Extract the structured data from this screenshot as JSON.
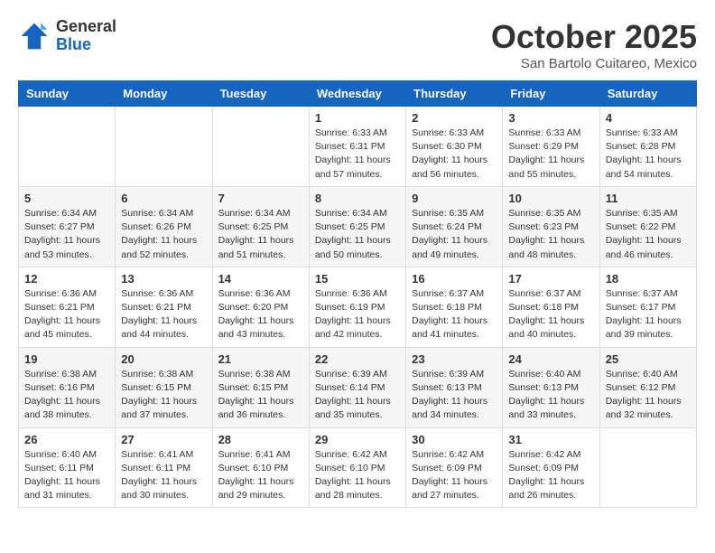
{
  "header": {
    "logo_general": "General",
    "logo_blue": "Blue",
    "month_title": "October 2025",
    "location": "San Bartolo Cuitareo, Mexico"
  },
  "weekdays": [
    "Sunday",
    "Monday",
    "Tuesday",
    "Wednesday",
    "Thursday",
    "Friday",
    "Saturday"
  ],
  "weeks": [
    [
      {
        "day": "",
        "info": ""
      },
      {
        "day": "",
        "info": ""
      },
      {
        "day": "",
        "info": ""
      },
      {
        "day": "1",
        "info": "Sunrise: 6:33 AM\nSunset: 6:31 PM\nDaylight: 11 hours\nand 57 minutes."
      },
      {
        "day": "2",
        "info": "Sunrise: 6:33 AM\nSunset: 6:30 PM\nDaylight: 11 hours\nand 56 minutes."
      },
      {
        "day": "3",
        "info": "Sunrise: 6:33 AM\nSunset: 6:29 PM\nDaylight: 11 hours\nand 55 minutes."
      },
      {
        "day": "4",
        "info": "Sunrise: 6:33 AM\nSunset: 6:28 PM\nDaylight: 11 hours\nand 54 minutes."
      }
    ],
    [
      {
        "day": "5",
        "info": "Sunrise: 6:34 AM\nSunset: 6:27 PM\nDaylight: 11 hours\nand 53 minutes."
      },
      {
        "day": "6",
        "info": "Sunrise: 6:34 AM\nSunset: 6:26 PM\nDaylight: 11 hours\nand 52 minutes."
      },
      {
        "day": "7",
        "info": "Sunrise: 6:34 AM\nSunset: 6:25 PM\nDaylight: 11 hours\nand 51 minutes."
      },
      {
        "day": "8",
        "info": "Sunrise: 6:34 AM\nSunset: 6:25 PM\nDaylight: 11 hours\nand 50 minutes."
      },
      {
        "day": "9",
        "info": "Sunrise: 6:35 AM\nSunset: 6:24 PM\nDaylight: 11 hours\nand 49 minutes."
      },
      {
        "day": "10",
        "info": "Sunrise: 6:35 AM\nSunset: 6:23 PM\nDaylight: 11 hours\nand 48 minutes."
      },
      {
        "day": "11",
        "info": "Sunrise: 6:35 AM\nSunset: 6:22 PM\nDaylight: 11 hours\nand 46 minutes."
      }
    ],
    [
      {
        "day": "12",
        "info": "Sunrise: 6:36 AM\nSunset: 6:21 PM\nDaylight: 11 hours\nand 45 minutes."
      },
      {
        "day": "13",
        "info": "Sunrise: 6:36 AM\nSunset: 6:21 PM\nDaylight: 11 hours\nand 44 minutes."
      },
      {
        "day": "14",
        "info": "Sunrise: 6:36 AM\nSunset: 6:20 PM\nDaylight: 11 hours\nand 43 minutes."
      },
      {
        "day": "15",
        "info": "Sunrise: 6:36 AM\nSunset: 6:19 PM\nDaylight: 11 hours\nand 42 minutes."
      },
      {
        "day": "16",
        "info": "Sunrise: 6:37 AM\nSunset: 6:18 PM\nDaylight: 11 hours\nand 41 minutes."
      },
      {
        "day": "17",
        "info": "Sunrise: 6:37 AM\nSunset: 6:18 PM\nDaylight: 11 hours\nand 40 minutes."
      },
      {
        "day": "18",
        "info": "Sunrise: 6:37 AM\nSunset: 6:17 PM\nDaylight: 11 hours\nand 39 minutes."
      }
    ],
    [
      {
        "day": "19",
        "info": "Sunrise: 6:38 AM\nSunset: 6:16 PM\nDaylight: 11 hours\nand 38 minutes."
      },
      {
        "day": "20",
        "info": "Sunrise: 6:38 AM\nSunset: 6:15 PM\nDaylight: 11 hours\nand 37 minutes."
      },
      {
        "day": "21",
        "info": "Sunrise: 6:38 AM\nSunset: 6:15 PM\nDaylight: 11 hours\nand 36 minutes."
      },
      {
        "day": "22",
        "info": "Sunrise: 6:39 AM\nSunset: 6:14 PM\nDaylight: 11 hours\nand 35 minutes."
      },
      {
        "day": "23",
        "info": "Sunrise: 6:39 AM\nSunset: 6:13 PM\nDaylight: 11 hours\nand 34 minutes."
      },
      {
        "day": "24",
        "info": "Sunrise: 6:40 AM\nSunset: 6:13 PM\nDaylight: 11 hours\nand 33 minutes."
      },
      {
        "day": "25",
        "info": "Sunrise: 6:40 AM\nSunset: 6:12 PM\nDaylight: 11 hours\nand 32 minutes."
      }
    ],
    [
      {
        "day": "26",
        "info": "Sunrise: 6:40 AM\nSunset: 6:11 PM\nDaylight: 11 hours\nand 31 minutes."
      },
      {
        "day": "27",
        "info": "Sunrise: 6:41 AM\nSunset: 6:11 PM\nDaylight: 11 hours\nand 30 minutes."
      },
      {
        "day": "28",
        "info": "Sunrise: 6:41 AM\nSunset: 6:10 PM\nDaylight: 11 hours\nand 29 minutes."
      },
      {
        "day": "29",
        "info": "Sunrise: 6:42 AM\nSunset: 6:10 PM\nDaylight: 11 hours\nand 28 minutes."
      },
      {
        "day": "30",
        "info": "Sunrise: 6:42 AM\nSunset: 6:09 PM\nDaylight: 11 hours\nand 27 minutes."
      },
      {
        "day": "31",
        "info": "Sunrise: 6:42 AM\nSunset: 6:09 PM\nDaylight: 11 hours\nand 26 minutes."
      },
      {
        "day": "",
        "info": ""
      }
    ]
  ]
}
